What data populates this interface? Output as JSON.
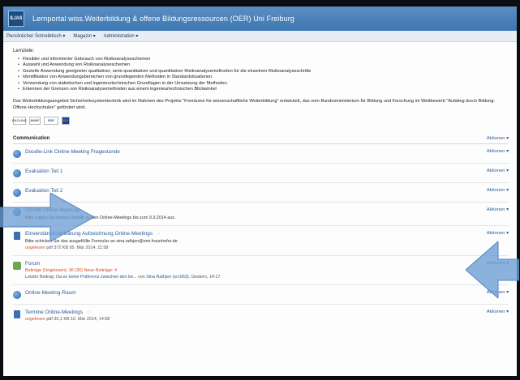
{
  "header": {
    "logo_text": "ILIAS",
    "title": "Lernportal wiss.Weiterbildung & offene Bildungsressourcen (OER) Uni Freiburg"
  },
  "menu": [
    "Persönlicher Schreibtisch ▾",
    "Magazin ▾",
    "Administration ▾"
  ],
  "lernziele": {
    "heading": "Lernziele:",
    "items": [
      "Flexibler und informierter Gebrauch von Risikoanalyseschemen",
      "Auswahl und Anwendung von Risikoanalyseschemen",
      "Gezielte Anwendung geeigneter qualitativer, semi-quantitativer und quantitativer Risikoanalysemethoden für die einzelnen Risikoanalyseschritte",
      "Identifikation von Anwendungsbereichen von grundlegenden Methoden in Standardsituationen.",
      "Verwendung von statistischen und ingenieurtechnischen Grundlagen in der Umsetzung der Methoden.",
      "Erkennen der Grenzen von Risikoanalysemethoden aus einem ingenieurtechnischen Blickwinkel"
    ]
  },
  "info_text": "Das Weiterbildungsangebot Sicherheitssystemtechnik wird im Rahmen des Projekts \"Freiräume für wissenschaftliche Weiterbildung\" entwickelt, das vom Bundesministerium für Bildung und Forschung im Wettbewerb \"Aufstieg durch Bildung: Offene Hochschulen\" gefördert wird.",
  "logos": [
    "BILDUNG",
    "BMBF",
    "ESF",
    "EU"
  ],
  "section": {
    "title": "Communication",
    "actions": "Aktionen"
  },
  "items": [
    {
      "title": "Doodle-Link Online-Meeting Fragestunde",
      "icon": "globe-icon",
      "desc": "",
      "meta": ""
    },
    {
      "title": "Evaluation Teil 1",
      "icon": "globe-icon",
      "desc": "",
      "meta": ""
    },
    {
      "title": "Evaluation Teil 2",
      "icon": "globe-icon",
      "desc": "",
      "meta": ""
    },
    {
      "title": "Doodle Online-Meetings",
      "icon": "globe-icon",
      "desc": "Bitte tragen Sie diesen Doodle zu den Online-Meetings bis zum 9.3.2014 aus.",
      "meta": ""
    },
    {
      "title": "Einverständniserklärung Aufzeichnung Online-Meetings",
      "icon": "file-icon",
      "desc": "Bitte schicken Sie das ausgefüllte Formular an sina.rathjen@emi.fraunhofer.de.",
      "meta_status": "ungelesen",
      "meta": "pdf   372 KB   05. Mär 2014, 11:58"
    },
    {
      "title": "Forum",
      "icon": "forum-icon",
      "desc": "",
      "forum_counts": "Beiträge (Ungelesen): 36 (36)   Neue Beiträge: 4",
      "forum_last_prefix": "Letzter Beitrag:",
      "forum_last_link": "Da es keine Präferenz zwischen den be...",
      "forum_last_by": "von",
      "forum_last_user": "Sina Rathjen (sr1063)",
      "forum_last_time": ", Gestern, 14:17"
    },
    {
      "title": "Online-Meeting-Raum",
      "icon": "globe-icon",
      "desc": "",
      "meta": ""
    },
    {
      "title": "Termine Online-Meetings",
      "icon": "file-icon",
      "desc": "",
      "meta_status": "ungelesen",
      "meta": "pdf   35,1 KB   10. Mär 2014, 14:58"
    }
  ],
  "colors": {
    "header": "#3d76b0",
    "link": "#2b5c96",
    "arrow": "#6e9fd3"
  }
}
